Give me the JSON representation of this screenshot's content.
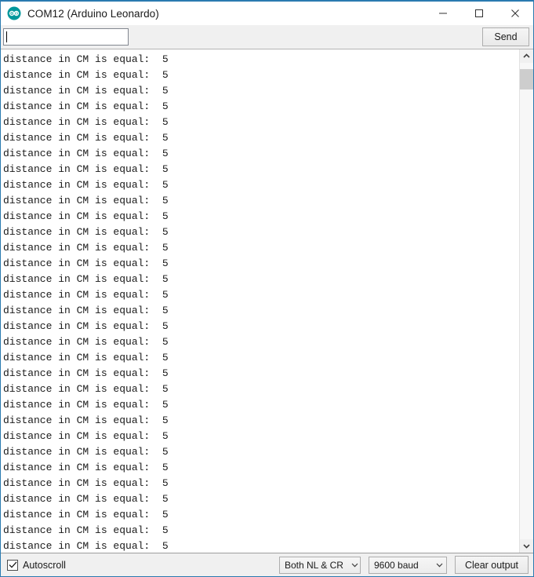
{
  "window": {
    "title": "COM12 (Arduino Leonardo)",
    "icon": "arduino-logo-icon",
    "accent_color": "#2a7ab0",
    "controls": {
      "minimize": "minimize-icon",
      "maximize": "maximize-icon",
      "close": "close-icon"
    }
  },
  "send": {
    "input_value": "",
    "input_placeholder": "",
    "button_label": "Send"
  },
  "console": {
    "line_text": "distance in CM is equal:  5",
    "line_count": 32,
    "lines": [
      "distance in CM is equal:  5",
      "distance in CM is equal:  5",
      "distance in CM is equal:  5",
      "distance in CM is equal:  5",
      "distance in CM is equal:  5",
      "distance in CM is equal:  5",
      "distance in CM is equal:  5",
      "distance in CM is equal:  5",
      "distance in CM is equal:  5",
      "distance in CM is equal:  5",
      "distance in CM is equal:  5",
      "distance in CM is equal:  5",
      "distance in CM is equal:  5",
      "distance in CM is equal:  5",
      "distance in CM is equal:  5",
      "distance in CM is equal:  5",
      "distance in CM is equal:  5",
      "distance in CM is equal:  5",
      "distance in CM is equal:  5",
      "distance in CM is equal:  5",
      "distance in CM is equal:  5",
      "distance in CM is equal:  5",
      "distance in CM is equal:  5",
      "distance in CM is equal:  5",
      "distance in CM is equal:  5",
      "distance in CM is equal:  5",
      "distance in CM is equal:  5",
      "distance in CM is equal:  5",
      "distance in CM is equal:  5",
      "distance in CM is equal:  5",
      "distance in CM is equal:  5",
      "distance in CM is equal:  5"
    ]
  },
  "scrollbar": {
    "up_arrow": "chevron-up-icon",
    "down_arrow": "chevron-down-icon"
  },
  "statusbar": {
    "autoscroll_label": "Autoscroll",
    "autoscroll_checked": true,
    "line_ending": "Both NL & CR",
    "baud_rate": "9600 baud",
    "clear_label": "Clear output"
  }
}
